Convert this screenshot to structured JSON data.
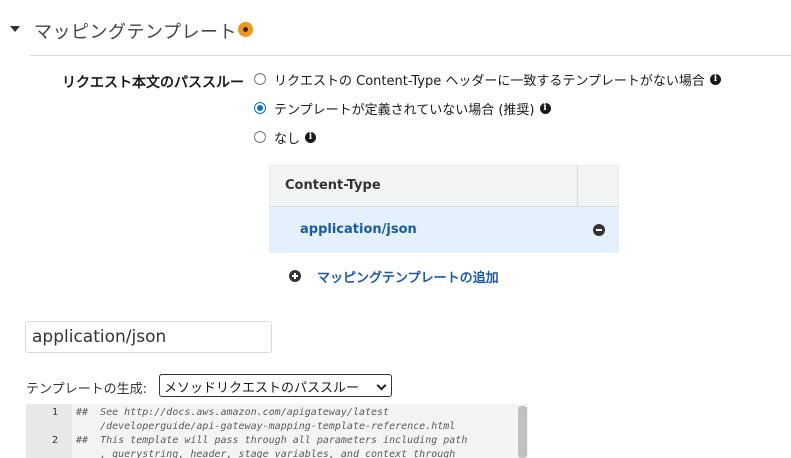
{
  "section": {
    "title": "マッピングテンプレート"
  },
  "passthrough": {
    "label": "リクエスト本文のパススルー",
    "options": [
      {
        "label": "リクエストの Content-Type ヘッダーに一致するテンプレートがない場合",
        "checked": false
      },
      {
        "label": "テンプレートが定義されていない場合 (推奨)",
        "checked": true
      },
      {
        "label": "なし",
        "checked": false
      }
    ]
  },
  "content_type_table": {
    "header": "Content-Type",
    "rows": [
      "application/json"
    ]
  },
  "add_template": {
    "label": "マッピングテンプレートの追加"
  },
  "content_type_input": {
    "value": "application/json"
  },
  "generate_template": {
    "label": "テンプレートの生成:",
    "selected": "メソッドリクエストのパススルー"
  },
  "editor": {
    "lines": [
      {
        "no": "1",
        "text": "##  See http://docs.aws.amazon.com/apigateway/latest"
      },
      {
        "no": "",
        "text": "    /developerguide/api-gateway-mapping-template-reference.html"
      },
      {
        "no": "2",
        "text": "##  This template will pass through all parameters including path"
      },
      {
        "no": "",
        "text": "    , querystring, header, stage variables, and context through"
      }
    ]
  },
  "colors": {
    "accent": "#0972d3",
    "link": "#1a5ba6",
    "warning": "#f0961e",
    "selected_row": "#e4f0fb"
  },
  "icons": {
    "collapse": "caret-down-icon",
    "warning": "warning-dot-icon",
    "info": "info-icon",
    "remove": "remove-icon",
    "add": "plus-icon"
  }
}
